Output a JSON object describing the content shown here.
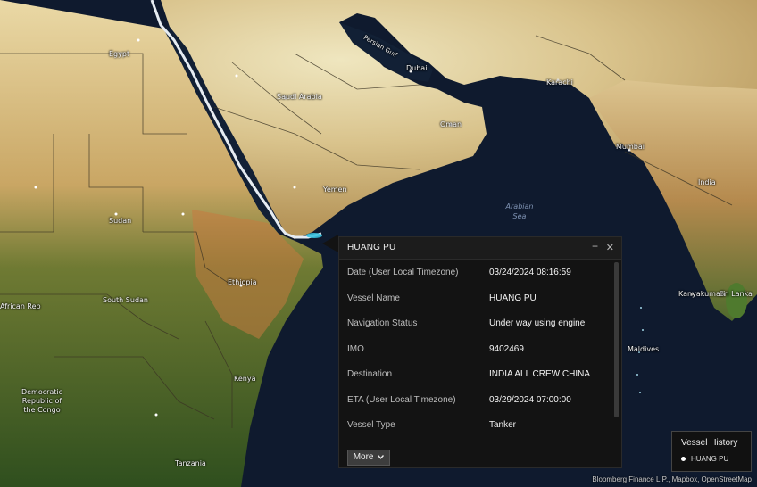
{
  "map": {
    "labels": {
      "egypt": "Egypt",
      "saudi": "Saudi Arabia",
      "yemen": "Yemen",
      "oman": "Oman",
      "dubai": "Dubai",
      "persian_gulf": "Persian Gulf",
      "sudan": "Sudan",
      "south_sudan": "South Sudan",
      "ethiopia": "Ethiopia",
      "karachi": "Karachi",
      "mumbai": "Mumbai",
      "india": "India",
      "sri_lanka": "Sri Lanka",
      "maldives": "Maldives",
      "kanyakumari": "Kanyakumari",
      "arabian_sea": "Arabian Sea",
      "drc": "Democratic Republic of the Congo",
      "tanzania": "Tanzania",
      "kenya": "Kenya",
      "african_rep": "African Rep"
    },
    "route_color": "#e6ecf2",
    "current_position_color": "#39c3e0"
  },
  "popup": {
    "title": "HUANG PU",
    "minimize_icon": "minimize-icon",
    "close_icon": "close-icon",
    "minimize_glyph": "−",
    "close_glyph": "✕",
    "rows": [
      {
        "key": "Date (User Local Timezone)",
        "value": "03/24/2024 08:16:59"
      },
      {
        "key": "Vessel Name",
        "value": "HUANG PU"
      },
      {
        "key": "Navigation Status",
        "value": "Under way using engine"
      },
      {
        "key": "IMO",
        "value": "9402469"
      },
      {
        "key": "Destination",
        "value": "INDIA ALL CREW CHINA"
      },
      {
        "key": "ETA (User Local Timezone)",
        "value": "03/29/2024 07:00:00"
      },
      {
        "key": "Vessel Type",
        "value": "Tanker"
      }
    ],
    "more_label": "More",
    "more_icon": "chevron-down-icon"
  },
  "legend": {
    "title": "Vessel History",
    "item": "HUANG PU"
  },
  "attribution": "Bloomberg Finance L.P., Mapbox, OpenStreetMap"
}
